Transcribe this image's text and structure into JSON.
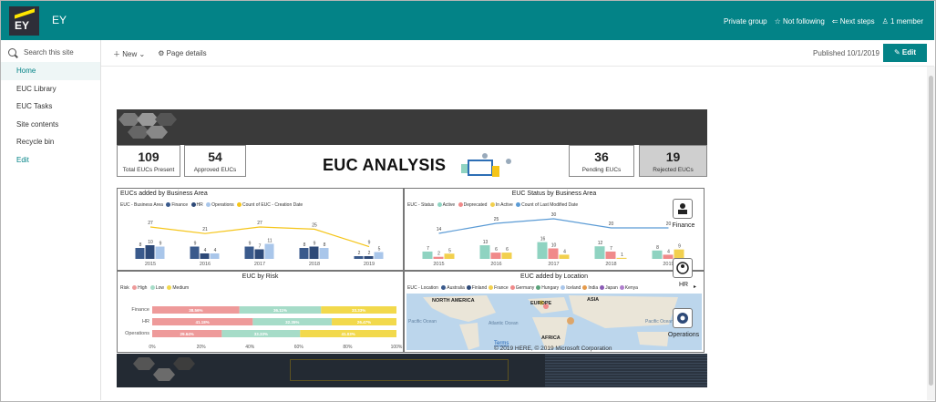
{
  "suite": {
    "logo_text": "EY",
    "site_title": "EY",
    "private_group": "Private group",
    "not_following": "Not following",
    "next_steps": "Next steps",
    "members": "1 member"
  },
  "nav": {
    "search_placeholder": "Search this site",
    "items": [
      {
        "label": "Home"
      },
      {
        "label": "EUC Library"
      },
      {
        "label": "EUC Tasks"
      },
      {
        "label": "Site contents"
      },
      {
        "label": "Recycle bin"
      },
      {
        "label": "Edit"
      }
    ]
  },
  "cmd": {
    "new_label": "New",
    "page_details": "Page details",
    "published": "Published 10/1/2019",
    "edit_label": "Edit"
  },
  "dashboard": {
    "title": "EUC ANALYSIS",
    "kpis": [
      {
        "value": "109",
        "label": "Total EUCs Present"
      },
      {
        "value": "54",
        "label": "Approved EUCs"
      },
      {
        "value": "36",
        "label": "Pending EUCs"
      },
      {
        "value": "19",
        "label": "Rejected EUCs"
      }
    ],
    "side": [
      {
        "label": "Finance"
      },
      {
        "label": "HR"
      },
      {
        "label": "Operations"
      }
    ],
    "colors": {
      "finance": "#3a5a8c",
      "hr": "#2e4a78",
      "operations": "#a9c6ea",
      "line": "#f5c518",
      "active": "#8fd3c1",
      "deprecated": "#f08a8a",
      "inactive": "#f2d04e",
      "line2": "#5b9bd5",
      "high": "#ee9a9a",
      "low": "#a6dcc8",
      "medium": "#f2d94c"
    }
  },
  "chart_data": [
    {
      "type": "bar",
      "title": "EUCs added by Business Area",
      "legend_title": "EUC - Business Area",
      "categories": [
        "2015",
        "2016",
        "2017",
        "2018",
        "2019"
      ],
      "series": [
        {
          "name": "Finance",
          "values": [
            8,
            9,
            9,
            8,
            2
          ]
        },
        {
          "name": "HR",
          "values": [
            10,
            4,
            7,
            9,
            2
          ]
        },
        {
          "name": "Operations",
          "values": [
            9,
            4,
            11,
            8,
            5
          ]
        },
        {
          "name": "Count of EUC - Creation Date",
          "values": [
            27,
            21,
            27,
            25,
            9
          ]
        }
      ]
    },
    {
      "type": "bar",
      "title": "EUC Status by Business Area",
      "legend_title": "EUC - Status",
      "categories": [
        "2015",
        "2016",
        "2017",
        "2018",
        "2019"
      ],
      "series": [
        {
          "name": "Active",
          "values": [
            7,
            13,
            16,
            12,
            8
          ]
        },
        {
          "name": "Deprecated",
          "values": [
            2,
            6,
            10,
            7,
            4
          ]
        },
        {
          "name": "In Active",
          "values": [
            5,
            6,
            4,
            1,
            9
          ]
        },
        {
          "name": "Count of Last Modified Date",
          "values": [
            14,
            25,
            30,
            20,
            20
          ]
        }
      ]
    },
    {
      "type": "bar",
      "title": "EUC by Risk",
      "legend_title": "Risk",
      "categories": [
        "Finance",
        "HR",
        "Operations"
      ],
      "series": [
        {
          "name": "High",
          "values": [
            38.56,
            41.18,
            29.64
          ]
        },
        {
          "name": "Low",
          "values": [
            36.11,
            32.35,
            33.33
          ]
        },
        {
          "name": "Medium",
          "values": [
            33.33,
            26.47,
            41.03
          ]
        }
      ],
      "x_ticks": [
        "0%",
        "20%",
        "40%",
        "60%",
        "80%",
        "100%"
      ]
    },
    {
      "type": "map",
      "title": "EUC added by Location",
      "legend_title": "EUC - Location",
      "locations": [
        "Australia",
        "Finland",
        "France",
        "Germany",
        "Hungary",
        "Iceland",
        "India",
        "Japan",
        "Kenya"
      ],
      "labels": [
        "NORTH AMERICA",
        "EUROPE",
        "ASIA",
        "Pacific Ocean",
        "Atlantic Ocean",
        "Pacific Ocean",
        "AFRICA"
      ],
      "attribution": "© 2019 HERE, © 2019 Microsoft Corporation",
      "terms": "Terms"
    }
  ]
}
